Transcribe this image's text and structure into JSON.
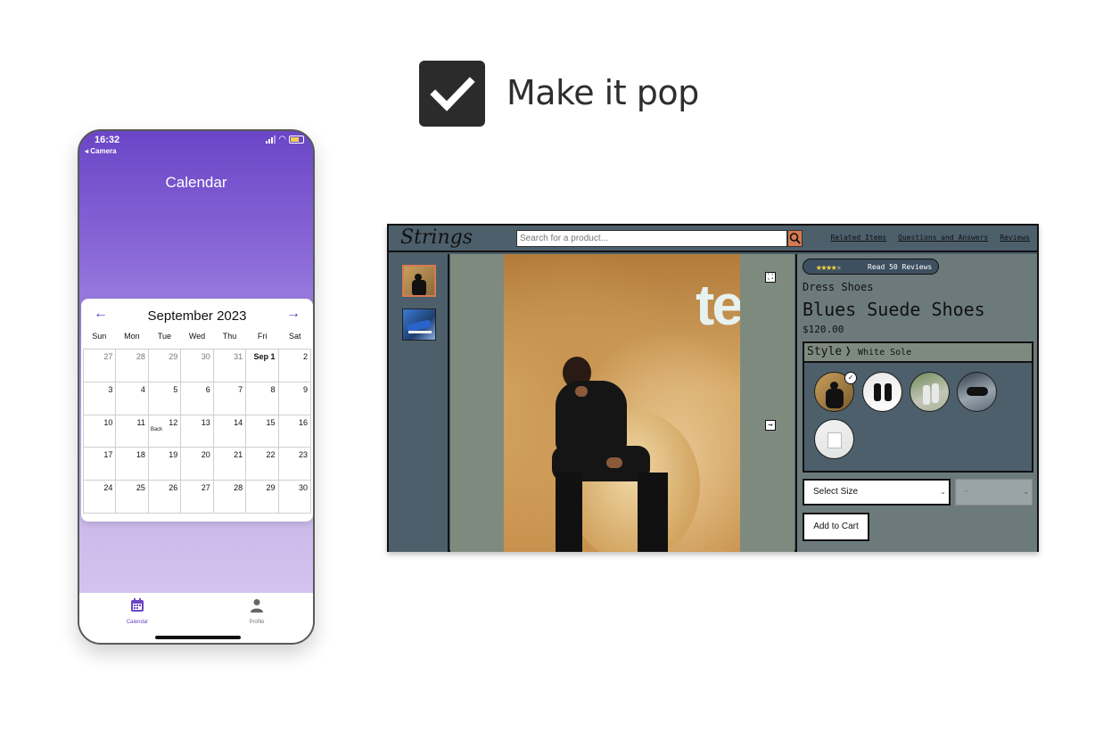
{
  "header": {
    "title": "Make it pop",
    "icon": "checkbox-checked-icon"
  },
  "phone": {
    "status": {
      "time": "16:32",
      "back_label": "◂ Camera"
    },
    "title": "Calendar",
    "calendar": {
      "month_label": "September 2023",
      "prev_icon": "arrow-left-icon",
      "next_icon": "arrow-right-icon",
      "weekdays": [
        "Sun",
        "Mon",
        "Tue",
        "Wed",
        "Thu",
        "Fri",
        "Sat"
      ],
      "days": [
        {
          "label": "27",
          "muted": true
        },
        {
          "label": "28",
          "muted": true
        },
        {
          "label": "29",
          "muted": true
        },
        {
          "label": "30",
          "muted": true
        },
        {
          "label": "31",
          "muted": true
        },
        {
          "label": "Sep 1",
          "today": true
        },
        {
          "label": "2"
        },
        {
          "label": "3"
        },
        {
          "label": "4"
        },
        {
          "label": "5"
        },
        {
          "label": "6"
        },
        {
          "label": "7"
        },
        {
          "label": "8"
        },
        {
          "label": "9"
        },
        {
          "label": "10"
        },
        {
          "label": "11"
        },
        {
          "label": "12",
          "event": "Back"
        },
        {
          "label": "13"
        },
        {
          "label": "14"
        },
        {
          "label": "15"
        },
        {
          "label": "16"
        },
        {
          "label": "17"
        },
        {
          "label": "18"
        },
        {
          "label": "19"
        },
        {
          "label": "20"
        },
        {
          "label": "21"
        },
        {
          "label": "22"
        },
        {
          "label": "23"
        },
        {
          "label": "24"
        },
        {
          "label": "25"
        },
        {
          "label": "26"
        },
        {
          "label": "27"
        },
        {
          "label": "28"
        },
        {
          "label": "29"
        },
        {
          "label": "30"
        }
      ]
    },
    "tabs": [
      {
        "label": "Calendar",
        "icon": "calendar-icon",
        "active": true
      },
      {
        "label": "Profile",
        "icon": "person-icon",
        "active": false
      }
    ],
    "accent": "#6a46c7"
  },
  "shop": {
    "logo": "Strings",
    "search": {
      "placeholder": "Search for a product..."
    },
    "nav_links": [
      "Related Items",
      "Questions and Answers",
      "Reviews"
    ],
    "reviews_label": "Read 50 Reviews",
    "rating": {
      "value": 4,
      "max": 5
    },
    "category": "Dress Shoes",
    "product_name": "Blues Suede Shoes",
    "price": "$120.00",
    "style_label": "Style",
    "style_value": "White Sole",
    "size_select": "Select Size",
    "qty_select": "-",
    "add_to_cart": "Add to Cart",
    "accent": "#d67a52",
    "background": "#4c5f6b"
  }
}
